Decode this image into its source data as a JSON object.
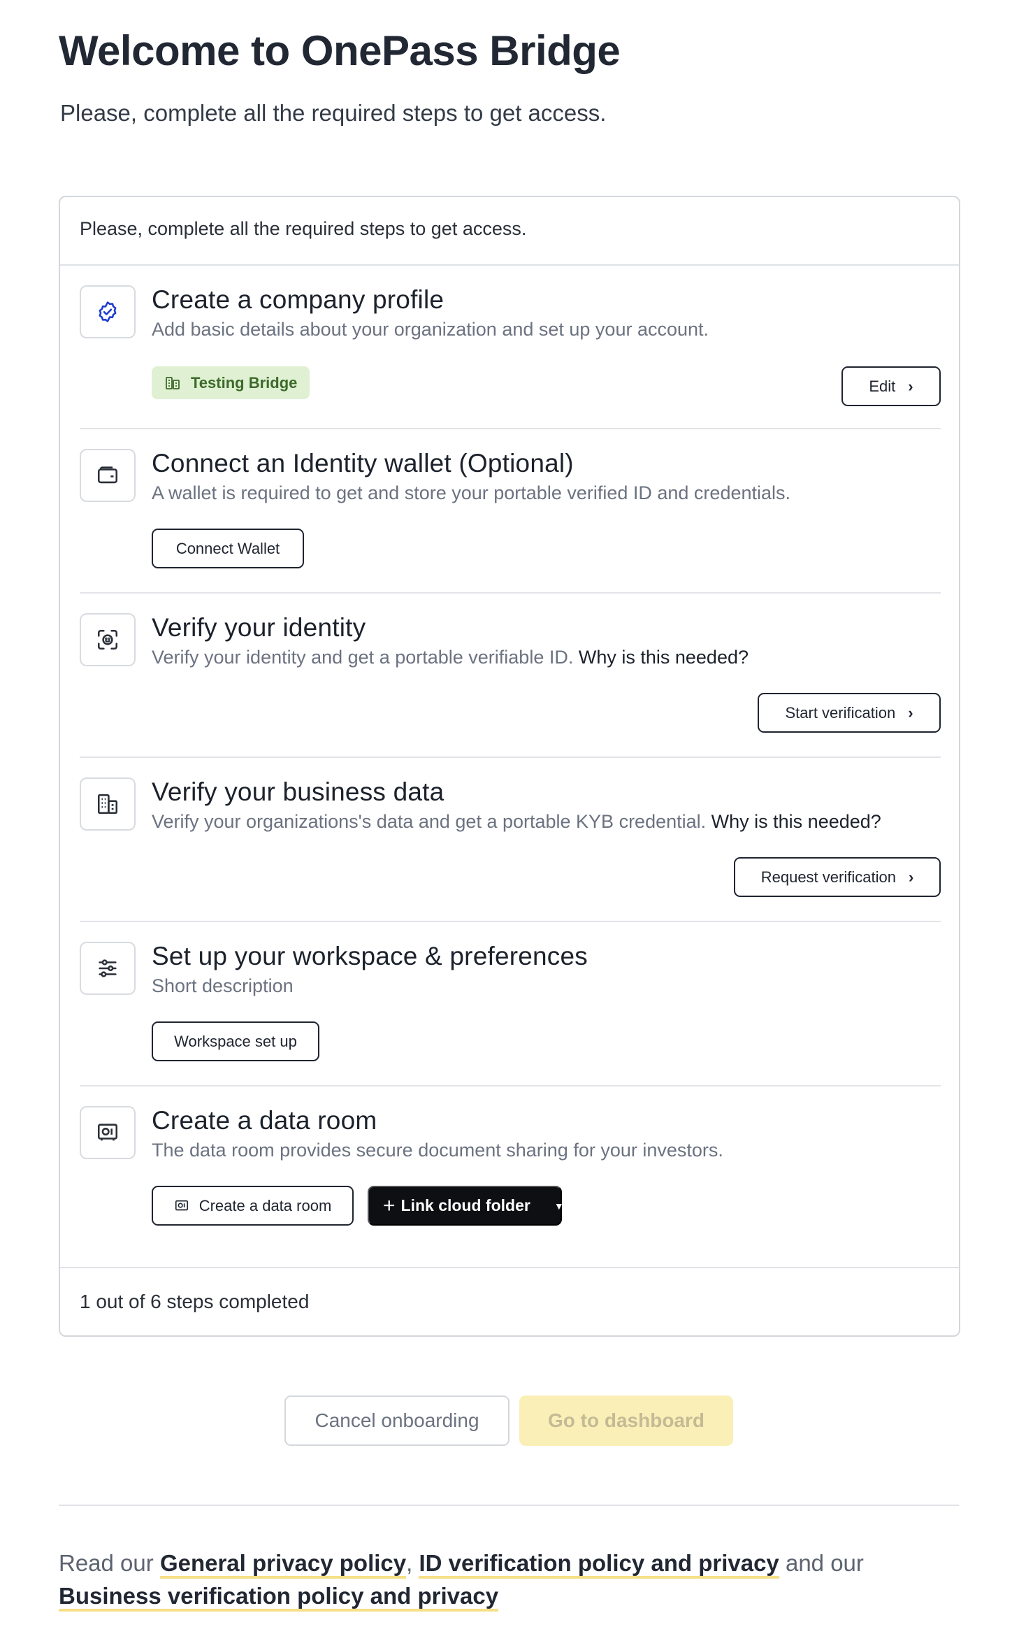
{
  "header": {
    "title": "Welcome to OnePass Bridge",
    "subtitle": "Please, complete all the required steps to get access."
  },
  "card": {
    "header_text": "Please, complete all the required steps to get access.",
    "footer_text": "1 out of 6 steps completed"
  },
  "steps": {
    "company": {
      "title": "Create a company profile",
      "description": "Add basic details about your organization and set up your account.",
      "badge": "Testing Bridge",
      "button": "Edit",
      "icon": "verified-badge-icon"
    },
    "wallet": {
      "title": "Connect an Identity wallet (Optional)",
      "description": "A wallet is required to get and store your portable verified ID and credentials.",
      "button": "Connect Wallet",
      "icon": "wallet-icon"
    },
    "identity": {
      "title": "Verify your identity",
      "description": "Verify your identity and get a portable verifiable ID.",
      "why": "Why is this needed?",
      "button": "Start verification",
      "icon": "face-scan-icon"
    },
    "business": {
      "title": "Verify your business data",
      "description": "Verify your organizations's data and get a portable KYB credential.",
      "why": "Why is this needed?",
      "button": "Request verification",
      "icon": "building-icon"
    },
    "workspace": {
      "title": "Set up your workspace & preferences",
      "description": "Short description",
      "button": "Workspace set up",
      "icon": "sliders-icon"
    },
    "dataroom": {
      "title": "Create a data room",
      "description": "The data room provides secure document sharing for your investors.",
      "button": "Create a data room",
      "button_secondary": "Link cloud folder",
      "icon": "vault-icon"
    }
  },
  "actions": {
    "cancel": "Cancel onboarding",
    "dashboard": "Go to dashboard"
  },
  "policy": {
    "prefix": "Read our",
    "link1": "General privacy policy",
    "sep1": ",",
    "link2": "ID verification policy and privacy",
    "mid": "and our",
    "link3": "Business verification policy and privacy"
  },
  "colors": {
    "accent_yellow": "#f7df86",
    "badge_green_bg": "#dff0d3",
    "verified_blue": "#1d3ccf"
  }
}
